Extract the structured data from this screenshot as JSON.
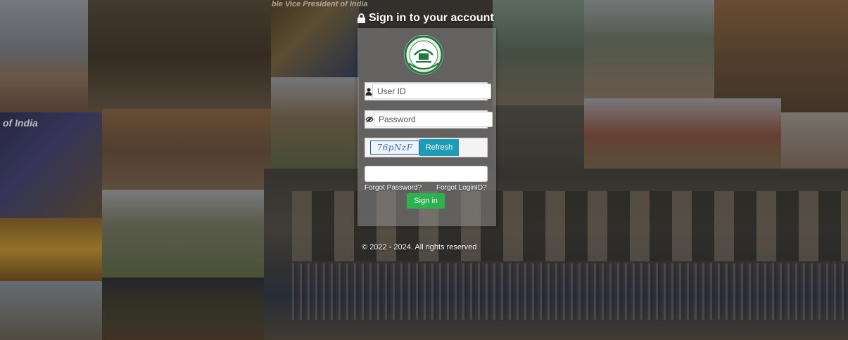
{
  "login": {
    "title": "Sign in to your account",
    "userid_placeholder": "User ID",
    "password_placeholder": "Password",
    "captcha_text": "76pNzF",
    "refresh_label": "Refresh",
    "captcha_input_value": "",
    "forgot_password": "Forgot Password?",
    "forgot_loginid": "Forgot LoginID?",
    "signin_label": "Sign in"
  },
  "footer": {
    "copyright": "© 2022 - 2024. All rights reserved"
  },
  "background": {
    "banner_text_top": "ble Vice President of India",
    "banner_text_left": "of India"
  },
  "colors": {
    "refresh_button": "#1e9bb5",
    "signin_button": "#2bb24c",
    "panel": "rgba(140,140,140,0.55)"
  },
  "icons": {
    "title": "lock-icon",
    "userid": "user-icon",
    "password": "eye-slash-icon",
    "logo": "university-logo"
  }
}
